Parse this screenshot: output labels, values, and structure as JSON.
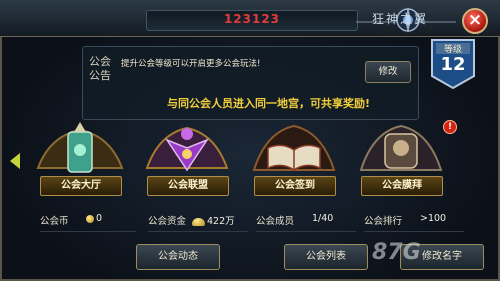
{
  "header": {
    "guild_name": "123123",
    "game_title": "狂神之翼"
  },
  "level": {
    "label": "等级",
    "value": "12"
  },
  "announcement": {
    "label": "公会公告",
    "text": "提升公会等级可以开启更多公会玩法!",
    "edit_label": "修改",
    "share_text": "与同公会人员进入同一地宫，可共享奖励!"
  },
  "features": [
    {
      "label": "公会大厅"
    },
    {
      "label": "公会联盟"
    },
    {
      "label": "公会签到"
    },
    {
      "label": "公会膜拜",
      "badge": "!"
    }
  ],
  "stats": {
    "coin_label": "公会币",
    "coin_value": "0",
    "funds_label": "公会资金",
    "funds_value": "422万",
    "members_label": "公会成员",
    "members_value": "1/40",
    "rank_label": "公会排行",
    "rank_value": ">100"
  },
  "buttons": {
    "dynamics": "公会动态",
    "list": "公会列表",
    "rename": "修改名字"
  },
  "watermark": "87G",
  "colors": {
    "guild_name": "#e33b3b",
    "share_text": "#f2cf3a",
    "accent_gold": "#b08e47"
  }
}
